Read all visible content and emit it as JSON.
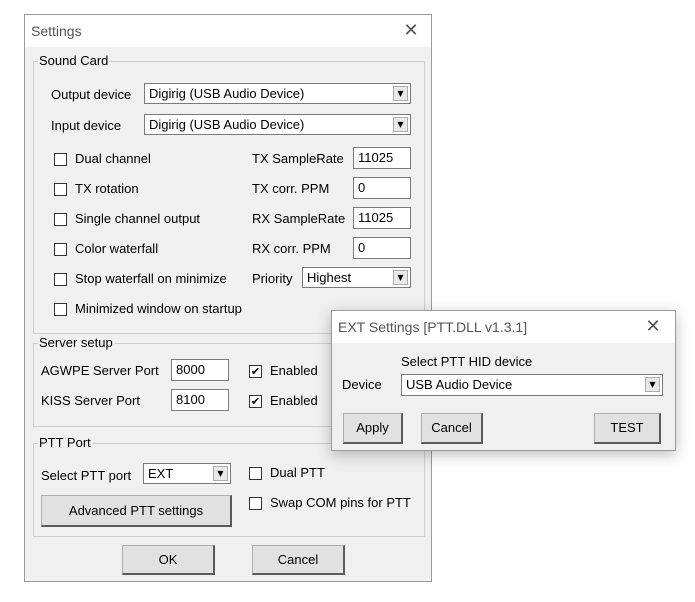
{
  "settings": {
    "title": "Settings",
    "sound_card": {
      "group_label": "Sound Card",
      "output_label": "Output device",
      "output_value": "Digirig (USB Audio Device)",
      "input_label": "Input device",
      "input_value": "Digirig (USB Audio Device)",
      "dual_channel": "Dual channel",
      "tx_rotation": "TX rotation",
      "single_channel": "Single channel output",
      "color_waterfall": "Color waterfall",
      "stop_waterfall": "Stop waterfall on minimize",
      "minimized_startup": "Minimized window on startup",
      "tx_samplerate_label": "TX SampleRate",
      "tx_samplerate_value": "11025",
      "tx_ppm_label": "TX corr. PPM",
      "tx_ppm_value": "0",
      "rx_samplerate_label": "RX SampleRate",
      "rx_samplerate_value": "11025",
      "rx_ppm_label": "RX corr. PPM",
      "rx_ppm_value": "0",
      "priority_label": "Priority",
      "priority_value": "Highest"
    },
    "server": {
      "group_label": "Server setup",
      "agwpe_label": "AGWPE Server Port",
      "agwpe_value": "8000",
      "kiss_label": "KISS Server Port",
      "kiss_value": "8100",
      "enabled_label": "Enabled",
      "agwpe_enabled": true,
      "kiss_enabled": true
    },
    "ptt": {
      "group_label": "PTT Port",
      "select_label": "Select PTT port",
      "select_value": "EXT",
      "dual_ptt": "Dual PTT",
      "swap_com": "Swap COM pins for PTT",
      "advanced_button": "Advanced PTT settings"
    },
    "ok_button": "OK",
    "cancel_button": "Cancel"
  },
  "ext": {
    "title": "EXT Settings [PTT.DLL v1.3.1]",
    "select_hid_label": "Select PTT HID device",
    "device_label": "Device",
    "device_value": "USB Audio Device",
    "apply_button": "Apply",
    "cancel_button": "Cancel",
    "test_button": "TEST"
  },
  "icons": {
    "close": "close-icon",
    "dropdown": "chevron-down-icon",
    "check": "checkmark-icon"
  }
}
